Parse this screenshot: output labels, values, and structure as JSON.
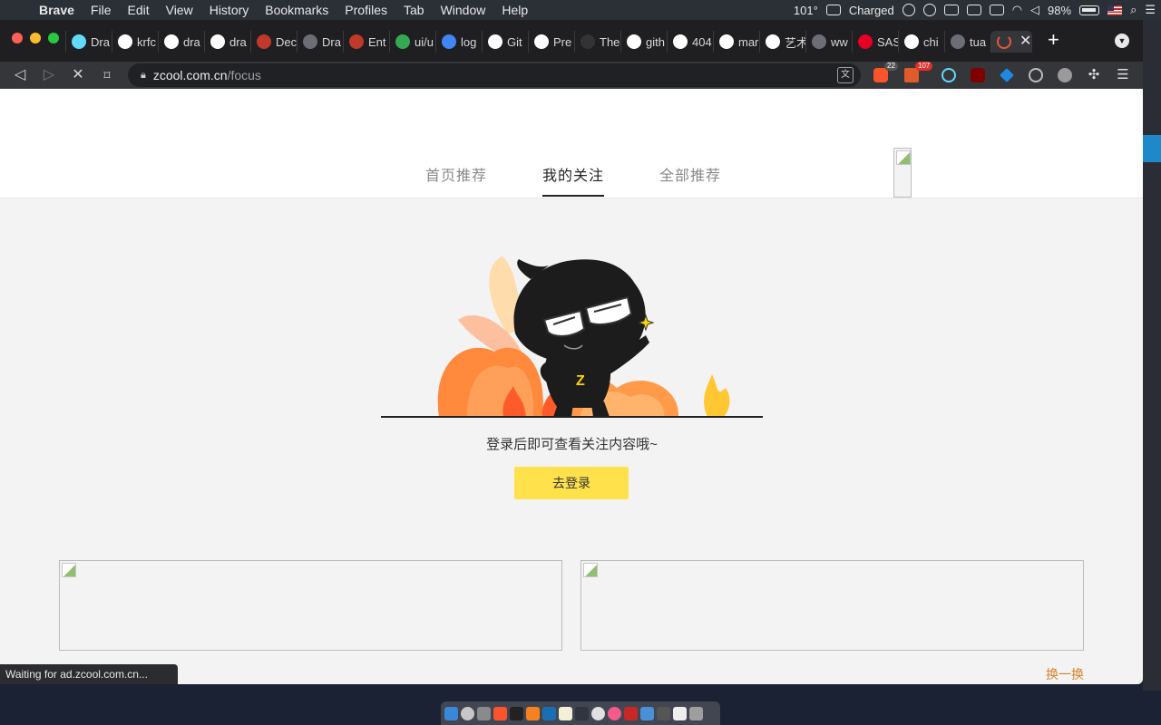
{
  "menubar": {
    "app": "Brave",
    "items": [
      "File",
      "Edit",
      "View",
      "History",
      "Bookmarks",
      "Profiles",
      "Tab",
      "Window",
      "Help"
    ],
    "temperature": "101°",
    "charge_status": "Charged",
    "battery_percent": "98%"
  },
  "tabs": [
    {
      "label": "Dra",
      "icon": "react-icon",
      "color": "#61dafb"
    },
    {
      "label": "krfc",
      "icon": "github-icon",
      "color": "#ffffff"
    },
    {
      "label": "dra",
      "icon": "github-icon",
      "color": "#ffffff"
    },
    {
      "label": "dra",
      "icon": "github-icon",
      "color": "#ffffff"
    },
    {
      "label": "Dec",
      "icon": "building-icon",
      "color": "#c0392b"
    },
    {
      "label": "Dra",
      "icon": "globe-icon",
      "color": "#9aa0a6"
    },
    {
      "label": "Ent",
      "icon": "building-icon",
      "color": "#c0392b"
    },
    {
      "label": "ui/u",
      "icon": "drive-icon",
      "color": "#34a853"
    },
    {
      "label": "log",
      "icon": "docs-icon",
      "color": "#4285f4"
    },
    {
      "label": "Git",
      "icon": "github-icon",
      "color": "#ffffff"
    },
    {
      "label": "Pre",
      "icon": "github-icon",
      "color": "#ffffff"
    },
    {
      "label": "The",
      "icon": "circle-icon",
      "color": "#333333"
    },
    {
      "label": "gith",
      "icon": "google-icon",
      "color": "#ffffff"
    },
    {
      "label": "404",
      "icon": "google-icon",
      "color": "#ffffff"
    },
    {
      "label": "mar",
      "icon": "google-icon",
      "color": "#ffffff"
    },
    {
      "label": "艺术",
      "icon": "google-icon",
      "color": "#ffffff"
    },
    {
      "label": "ww",
      "icon": "globe-icon",
      "color": "#9aa0a6"
    },
    {
      "label": "SAS",
      "icon": "pinterest-icon",
      "color": "#e60023"
    },
    {
      "label": "chi",
      "icon": "google-icon",
      "color": "#ffffff"
    },
    {
      "label": "tua",
      "icon": "globe-icon",
      "color": "#9aa0a6"
    }
  ],
  "active_tab": {
    "icon": "loading-spinner-icon"
  },
  "address": {
    "host": "zcool.com.cn",
    "path": "/focus"
  },
  "extensions": {
    "brave_badge": "22",
    "rewards_badge": "107"
  },
  "page": {
    "nav_tabs": [
      "首页推荐",
      "我的关注",
      "全部推荐"
    ],
    "active_nav": "我的关注",
    "empty_message": "登录后即可查看关注内容哦~",
    "login_button": "去登录",
    "swap_link": "换一换",
    "mascot_letter": "Z"
  },
  "status_bar": "Waiting for ad.zcool.com.cn..."
}
